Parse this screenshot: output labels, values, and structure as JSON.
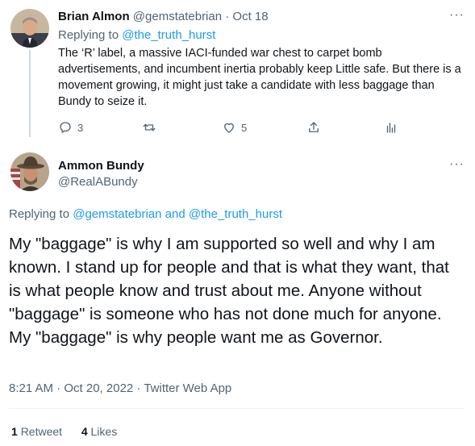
{
  "tweet1": {
    "display_name": "Brian Almon",
    "handle": "@gemstatebrian",
    "separator": " · ",
    "date": "Oct 18",
    "replying_label": "Replying to",
    "replying_to": "@the_truth_hurst",
    "text": "The ‘R’ label, a massive IACI-funded war chest to carpet bomb advertisements, and incumbent inertia probably keep Little safe. But there is a movement growing, it might just take a candidate with less baggage than Bundy to seize it.",
    "reply_count": "3",
    "like_count": "5",
    "more_label": "···"
  },
  "tweet2": {
    "display_name": "Ammon Bundy",
    "handle": "@RealABundy",
    "more_label": "···",
    "replying_label": "Replying to",
    "replying_to_1": "@gemstatebrian",
    "replying_and": " and ",
    "replying_to_2": "@the_truth_hurst",
    "text": "My \"baggage\" is why I am supported so well and why I am known. I stand up for people and that is what they want, that is what people know and trust about me. Anyone without \"baggage\" is someone who has not done much for anyone. My \"baggage\" is why people want me as Governor.",
    "timestamp": "8:21 AM · Oct 20, 2022 · Twitter Web App",
    "retweet_count": "1",
    "retweet_label": "Retweet",
    "like_count": "4",
    "like_label": "Likes"
  },
  "icons": [
    "reply-icon",
    "retweet-icon",
    "like-icon",
    "share-icon",
    "analytics-icon",
    "more-icon"
  ],
  "colors": {
    "accent": "#1d9bf0",
    "text": "#0f1419",
    "muted": "#536471",
    "line": "#cfd9de"
  }
}
